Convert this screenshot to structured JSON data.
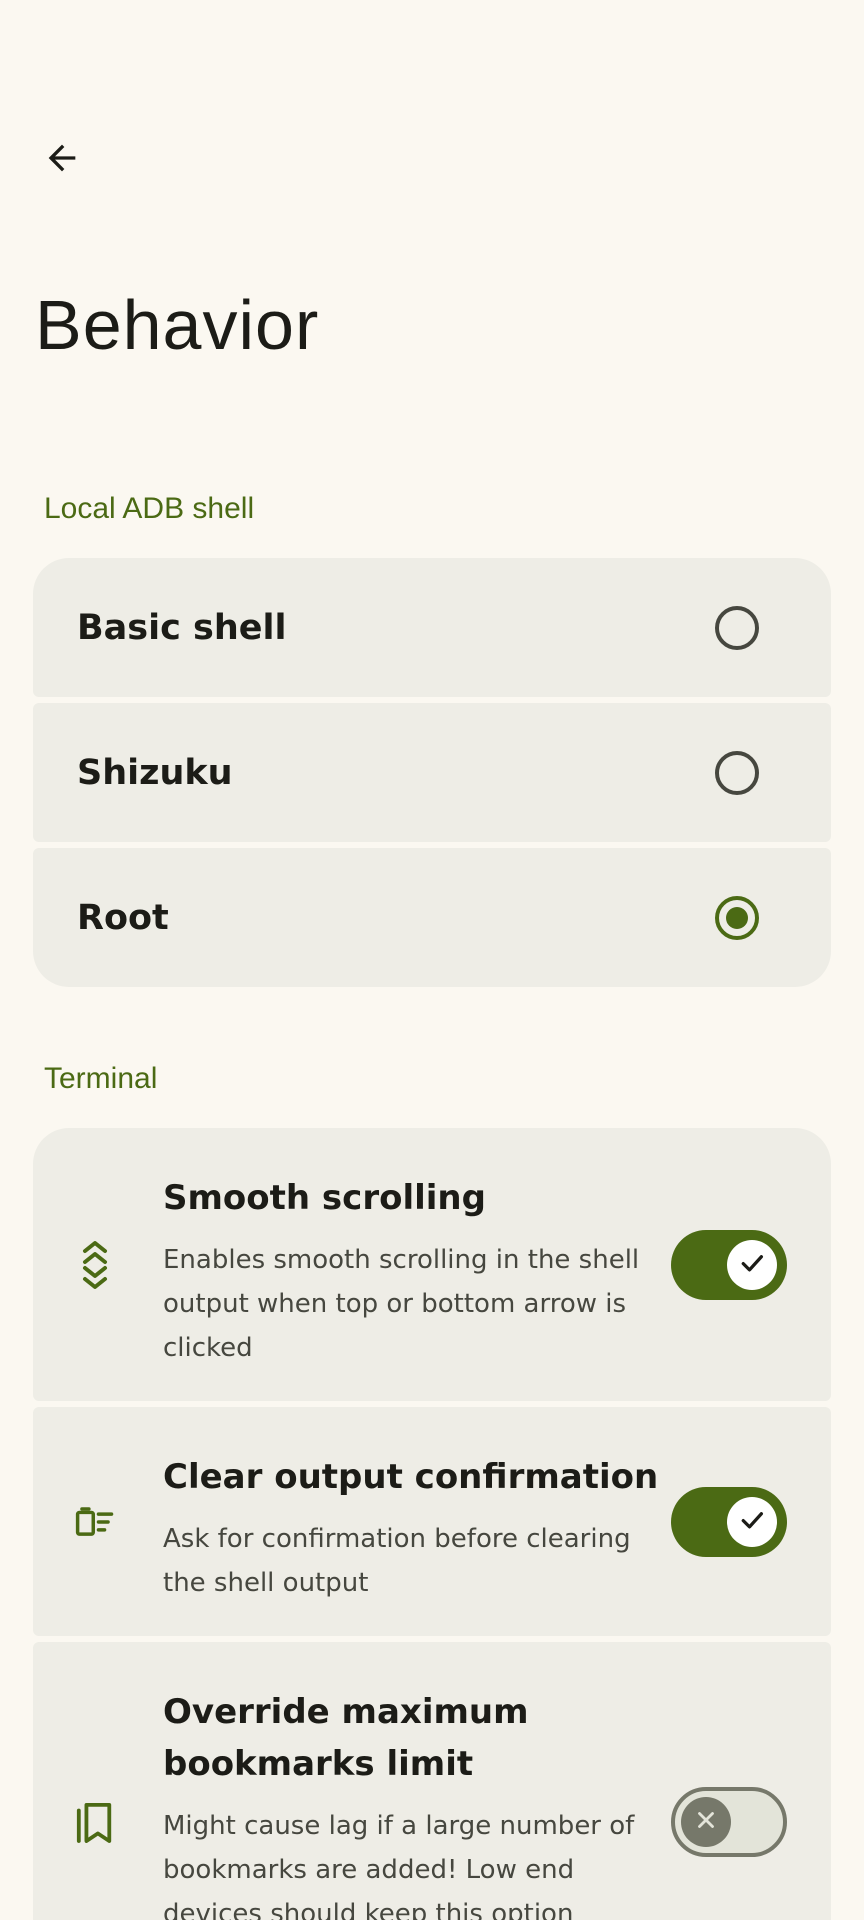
{
  "header": {
    "back_icon": "arrow-back-icon",
    "title": "Behavior"
  },
  "colors": {
    "accent": "#4b6a14",
    "background": "#fbf8f1",
    "card": "#eeede6"
  },
  "sections": {
    "local_adb": {
      "label": "Local ADB shell",
      "options": [
        {
          "label": "Basic shell",
          "selected": false
        },
        {
          "label": "Shizuku",
          "selected": false
        },
        {
          "label": "Root",
          "selected": true
        }
      ]
    },
    "terminal": {
      "label": "Terminal",
      "items": [
        {
          "icon": "chevrons-up-down-icon",
          "title": "Smooth scrolling",
          "description": "Enables smooth scrolling in the shell output when top or bottom arrow is clicked",
          "enabled": true
        },
        {
          "icon": "clear-output-icon",
          "title": "Clear output confirmation",
          "description": "Ask for confirmation before clearing the shell output",
          "enabled": true
        },
        {
          "icon": "bookmarks-icon",
          "title": "Override maximum bookmarks limit",
          "description": "Might cause lag if a large number of bookmarks are added! Low end devices should keep this option",
          "enabled": false
        }
      ]
    }
  }
}
